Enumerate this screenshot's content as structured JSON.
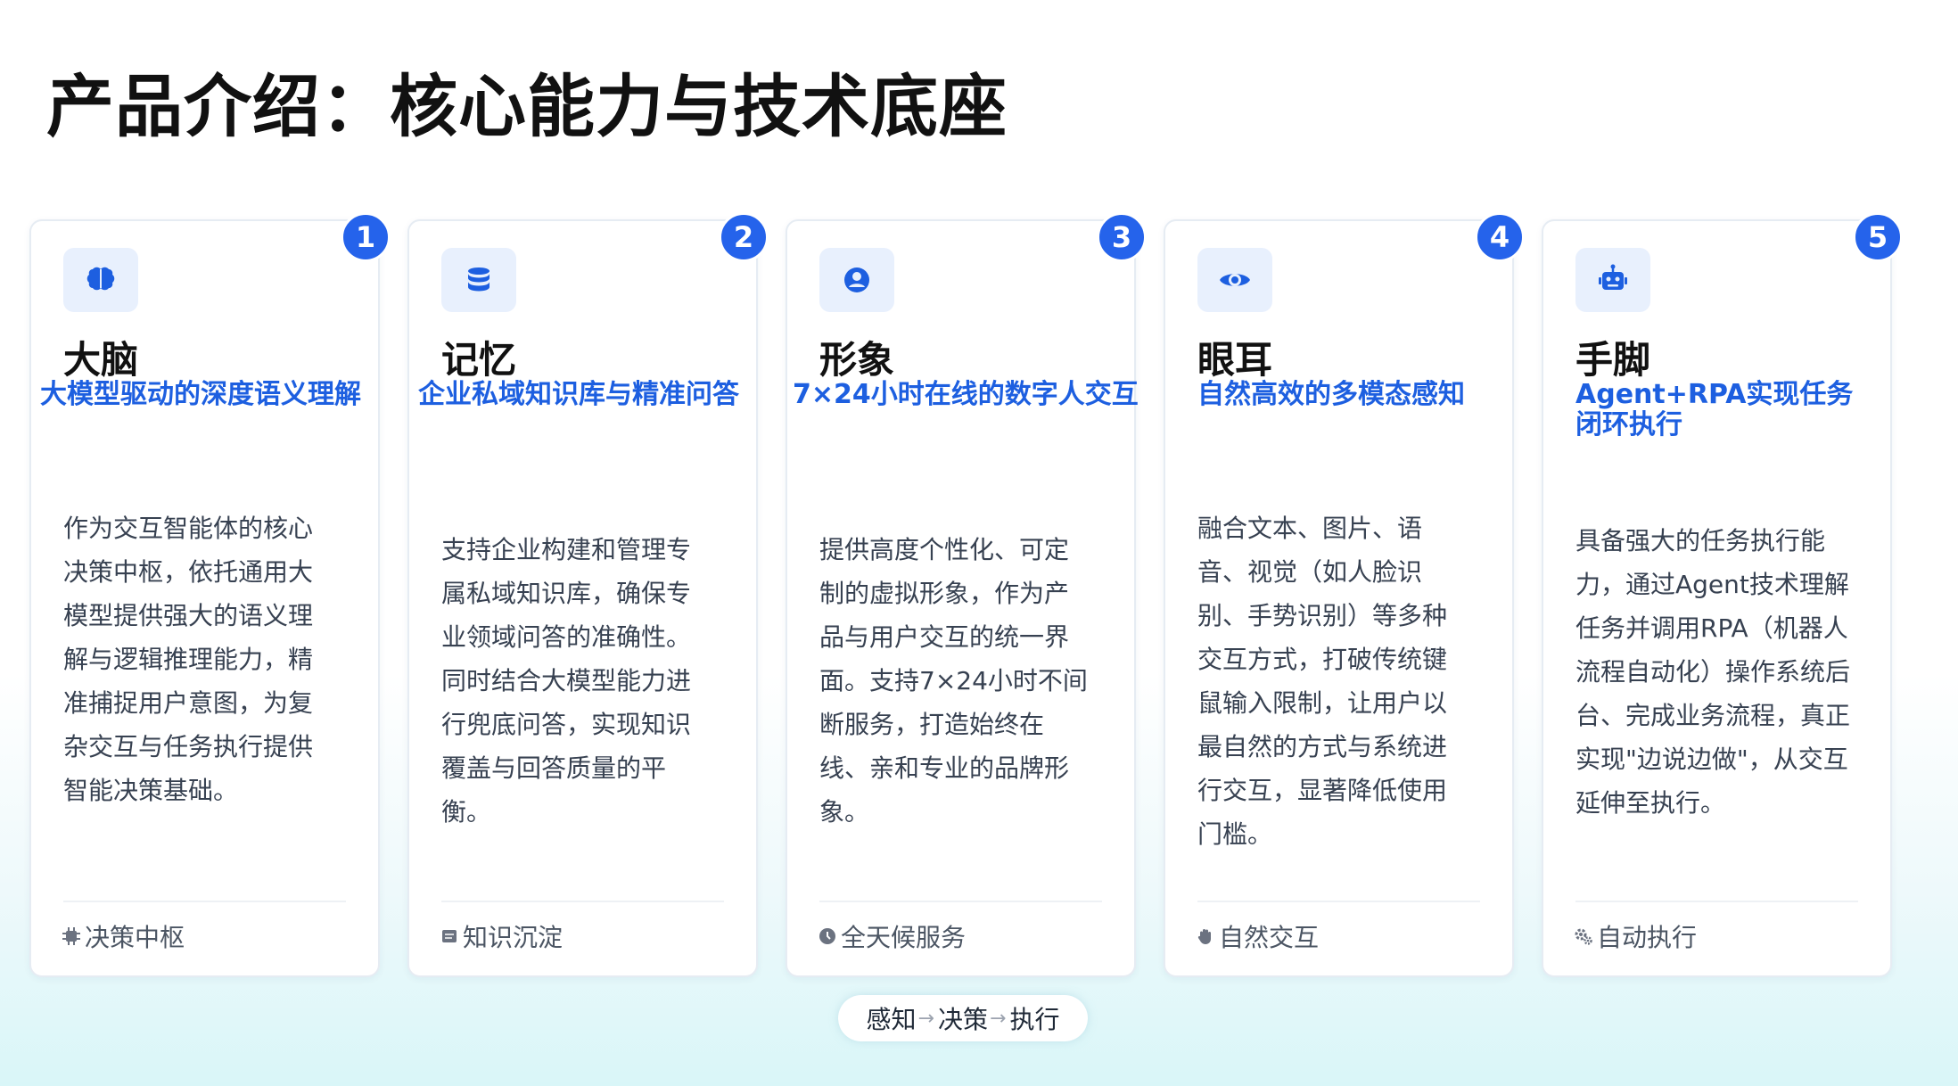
{
  "page_title": "产品介绍：核心能力与技术底座",
  "accent_color": "#2563eb",
  "cards": [
    {
      "number": "1",
      "icon": "brain-icon",
      "title": "大脑",
      "subtitle": "大模型驱动的深度语义理解",
      "description": "作为交互智能体的核心决策中枢，依托通用大模型提供强大的语义理解与逻辑推理能力，精准捕捉用户意图，为复杂交互与任务执行提供智能决策基础。",
      "footer_icon": "chip-icon",
      "footer": "决策中枢"
    },
    {
      "number": "2",
      "icon": "database-icon",
      "title": "记忆",
      "subtitle": "企业私域知识库与精准问答",
      "description": "支持企业构建和管理专属私域知识库，确保专业领域问答的准确性。同时结合大模型能力进行兜底问答，实现知识覆盖与回答质量的平衡。",
      "footer_icon": "book-icon",
      "footer": "知识沉淀"
    },
    {
      "number": "3",
      "icon": "user-icon",
      "title": "形象",
      "subtitle": "7×24小时在线的数字人交互",
      "description": "提供高度个性化、可定制的虚拟形象，作为产品与用户交互的统一界面。支持7×24小时不间断服务，打造始终在线、亲和专业的品牌形象。",
      "footer_icon": "clock-icon",
      "footer": "全天候服务"
    },
    {
      "number": "4",
      "icon": "eye-icon",
      "title": "眼耳",
      "subtitle": "自然高效的多模态感知",
      "description": "融合文本、图片、语音、视觉（如人脸识别、手势识别）等多种交互方式，打破传统键鼠输入限制，让用户以最自然的方式与系统进行交互，显著降低使用门槛。",
      "footer_icon": "hand-icon",
      "footer": "自然交互"
    },
    {
      "number": "5",
      "icon": "robot-icon",
      "title": "手脚",
      "subtitle": "Agent+RPA实现任务闭环执行",
      "description": "具备强大的任务执行能力，通过Agent技术理解任务并调用RPA（机器人流程自动化）操作系统后台、完成业务流程，真正实现\"边说边做\"，从交互延伸至执行。",
      "footer_icon": "gears-icon",
      "footer": "自动执行"
    }
  ],
  "flow": {
    "step1": "感知",
    "step2": "决策",
    "step3": "执行",
    "arrow": "→"
  }
}
